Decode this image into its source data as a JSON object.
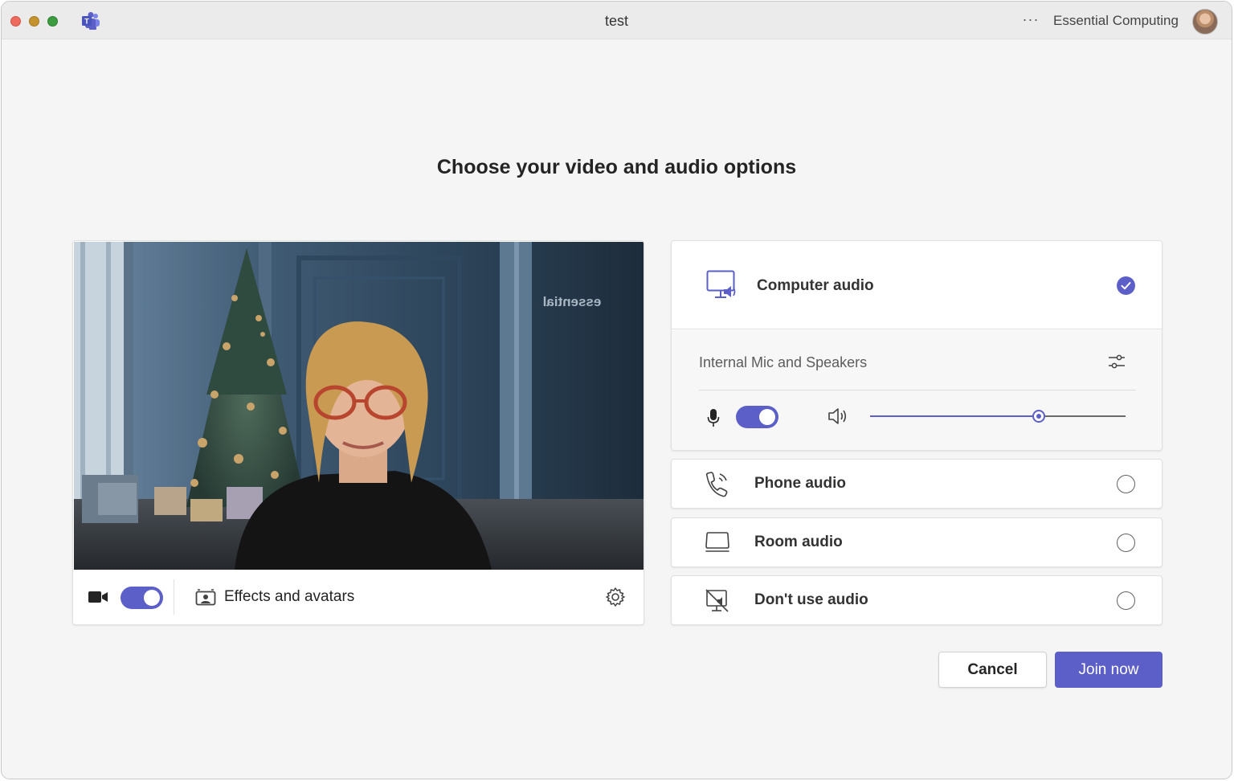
{
  "window": {
    "title": "test",
    "org_name": "Essential Computing",
    "more_label": "···"
  },
  "heading": "Choose your video and audio options",
  "video": {
    "effects_label": "Effects and avatars",
    "camera_on": true,
    "background_watermark": "essential"
  },
  "audio": {
    "computer_audio_label": "Computer audio",
    "device_label": "Internal Mic and Speakers",
    "mic_on": true,
    "speaker_volume": 0.66,
    "selected": "computer"
  },
  "options": {
    "phone_label": "Phone audio",
    "room_label": "Room audio",
    "none_label": "Don't use audio"
  },
  "buttons": {
    "cancel": "Cancel",
    "join": "Join now"
  },
  "colors": {
    "accent": "#5b5fc7",
    "background": "#f5f5f5"
  }
}
